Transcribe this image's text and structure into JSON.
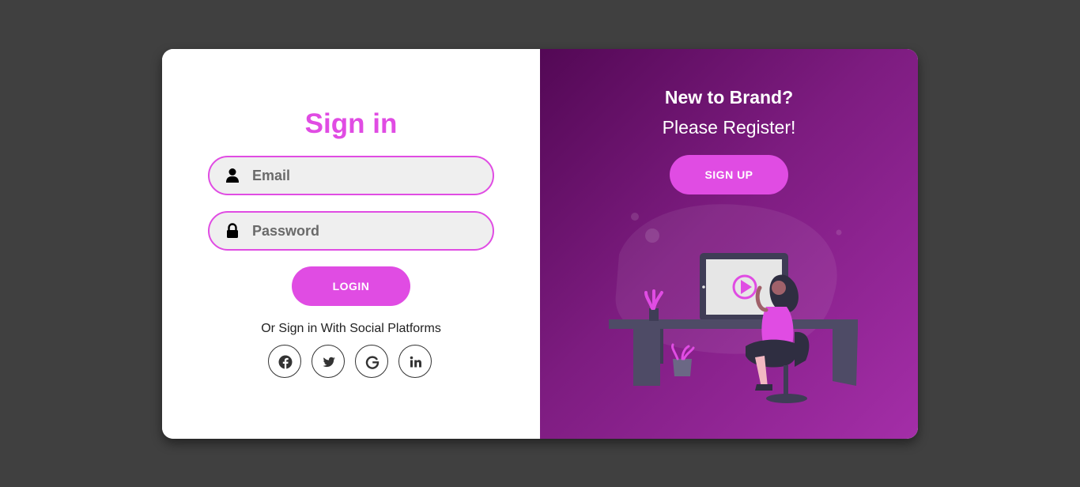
{
  "signin": {
    "title": "Sign in",
    "email_placeholder": "Email",
    "password_placeholder": "Password",
    "login_label": "LOGIN",
    "social_text": "Or Sign in With Social Platforms",
    "social_icons": [
      "facebook-icon",
      "twitter-icon",
      "google-icon",
      "linkedin-icon"
    ]
  },
  "register": {
    "title": "New to Brand?",
    "subtitle": "Please Register!",
    "signup_label": "SIGN UP"
  },
  "colors": {
    "accent": "#e04ce3",
    "background": "#404040",
    "panel_gradient_start": "#530855",
    "panel_gradient_end": "#a42ea8"
  }
}
